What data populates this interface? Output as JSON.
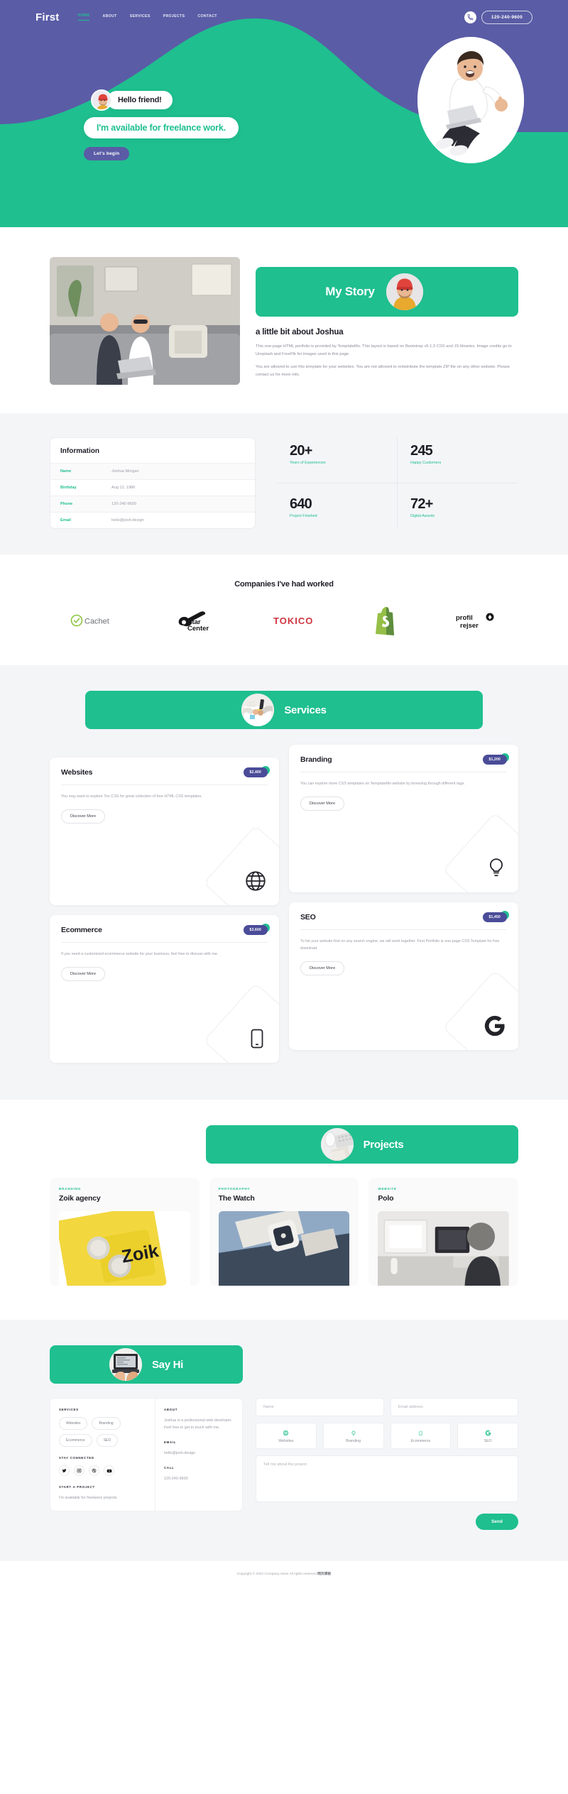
{
  "brand": "First",
  "nav": {
    "items": [
      {
        "label": "HOME",
        "active": true
      },
      {
        "label": "ABOUT",
        "active": false
      },
      {
        "label": "SERVICES",
        "active": false
      },
      {
        "label": "PROJECTS",
        "active": false
      },
      {
        "label": "CONTACT",
        "active": false
      }
    ],
    "phone": "120-240-9600",
    "phone_icon": "phone-icon"
  },
  "hero": {
    "bubble1": "Hello friend!",
    "bubble2": "I'm available for freelance work.",
    "cta": "Let's begin",
    "avatar_icon": "avatar-man-red-beanie",
    "photo_icon": "hero-photo-man-laptop"
  },
  "story": {
    "banner_title": "My Story",
    "banner_avatar": "avatar-man-yellow-sweater",
    "photo_icon": "couple-on-couch-photo",
    "title": "a little bit about Joshua",
    "paragraphs": [
      "This one-page HTML portfolio is provided by TemplateMo. This layout is based on Bootstrap v5.1.3 CSS and JS libraries. Image credits go to Unsplash and FreePik for images used in this page.",
      "You are allowed to use this template for your websites. You are not allowed to redistribute the template ZIP file on any other website. Please contact us for more info."
    ]
  },
  "information": {
    "heading": "Information",
    "rows": [
      {
        "key": "Name",
        "value": "Joshua Morgan"
      },
      {
        "key": "Birthday",
        "value": "Aug 12, 1986"
      },
      {
        "key": "Phone",
        "value": "120-240-9600"
      },
      {
        "key": "Email",
        "value": "hello@josh.design"
      }
    ]
  },
  "stats": [
    {
      "number": "20+",
      "label": "Years of Experiences"
    },
    {
      "number": "245",
      "label": "Happy Customers"
    },
    {
      "number": "640",
      "label": "Project Finished"
    },
    {
      "number": "72+",
      "label": "Digital Awards"
    }
  ],
  "companies": {
    "title": "Companies I've had worked",
    "logos": [
      {
        "name": "Cachet",
        "icon": "cachet-logo"
      },
      {
        "name": "Guitar Center",
        "icon": "guitar-center-logo"
      },
      {
        "name": "TOKICO",
        "icon": "tokico-logo"
      },
      {
        "name": "Shopify",
        "icon": "shopify-logo"
      },
      {
        "name": "profil rejser",
        "icon": "profil-rejser-logo"
      }
    ]
  },
  "services": {
    "banner_title": "Services",
    "banner_image": "handshake-desk-photo",
    "cards": [
      {
        "title": "Websites",
        "price": "$2,400",
        "text": "You may want to explore Too CSS for great collection of free HTML CSS templates.",
        "button": "Discover More",
        "icon": "globe-icon"
      },
      {
        "title": "Branding",
        "price": "$1,200",
        "text": "You can explore more CSS templates on TemplateMo website by browsing through different tags.",
        "button": "Discover More",
        "icon": "lightbulb-icon"
      },
      {
        "title": "Ecommerce",
        "price": "$3,600",
        "text": "If you need a customized ecommerce website for your business, feel free to discuss with me.",
        "button": "Discover More",
        "icon": "mobile-icon"
      },
      {
        "title": "SEO",
        "price": "$1,450",
        "text": "To list your website first on any search engine, we will work together. First Portfolio is one-page CSS Template for free download.",
        "button": "Discover More",
        "icon": "google-g-icon"
      }
    ]
  },
  "projects": {
    "banner_title": "Projects",
    "banner_image": "keyboard-mouse-desk-photo",
    "items": [
      {
        "category": "BRANDING",
        "name": "Zoik agency",
        "image": "zoik-cans-photo"
      },
      {
        "category": "PHOTOGRAPHY",
        "name": "The Watch",
        "image": "watch-wrist-photo"
      },
      {
        "category": "WEBSITE",
        "name": "Polo",
        "image": "desk-workspace-photo"
      }
    ]
  },
  "contact": {
    "banner_title": "Say Hi",
    "banner_image": "hands-on-laptop-photo",
    "services_label": "SERVICES",
    "service_chips": [
      "Websites",
      "Branding",
      "Ecommerce",
      "SEO"
    ],
    "stay_connected_label": "STAY CONNECTED",
    "socials": [
      {
        "name": "twitter-icon"
      },
      {
        "name": "instagram-icon"
      },
      {
        "name": "dribbble-icon"
      },
      {
        "name": "youtube-icon"
      }
    ],
    "start_project_label": "START A PROJECT",
    "start_project_text": "I'm available for freelance projects",
    "about_label": "ABOUT",
    "about_text": "Joshua is a professional web developer. Feel free to get in touch with me.",
    "email_label": "EMAIL",
    "email_value": "hello@josh.design",
    "call_label": "CALL",
    "call_value": "120-240-9600",
    "form": {
      "name_placeholder": "Name",
      "email_placeholder": "Email address",
      "message_placeholder": "Tell me about the project",
      "options": [
        {
          "label": "Websites",
          "icon": "globe-icon"
        },
        {
          "label": "Branding",
          "icon": "lightbulb-icon"
        },
        {
          "label": "Ecommerce",
          "icon": "mobile-icon"
        },
        {
          "label": "SEO",
          "icon": "google-g-icon"
        }
      ],
      "send_label": "Send"
    }
  },
  "footer": {
    "text": "Copyright © 2022 Company name All rights reserved.",
    "suffix": "网页模板"
  },
  "colors": {
    "purple": "#5a5ca6",
    "green": "#1fbf8f",
    "dark": "#1d1d26",
    "grey_bg": "#f4f5f7",
    "price_pill": "#4a4c98"
  }
}
